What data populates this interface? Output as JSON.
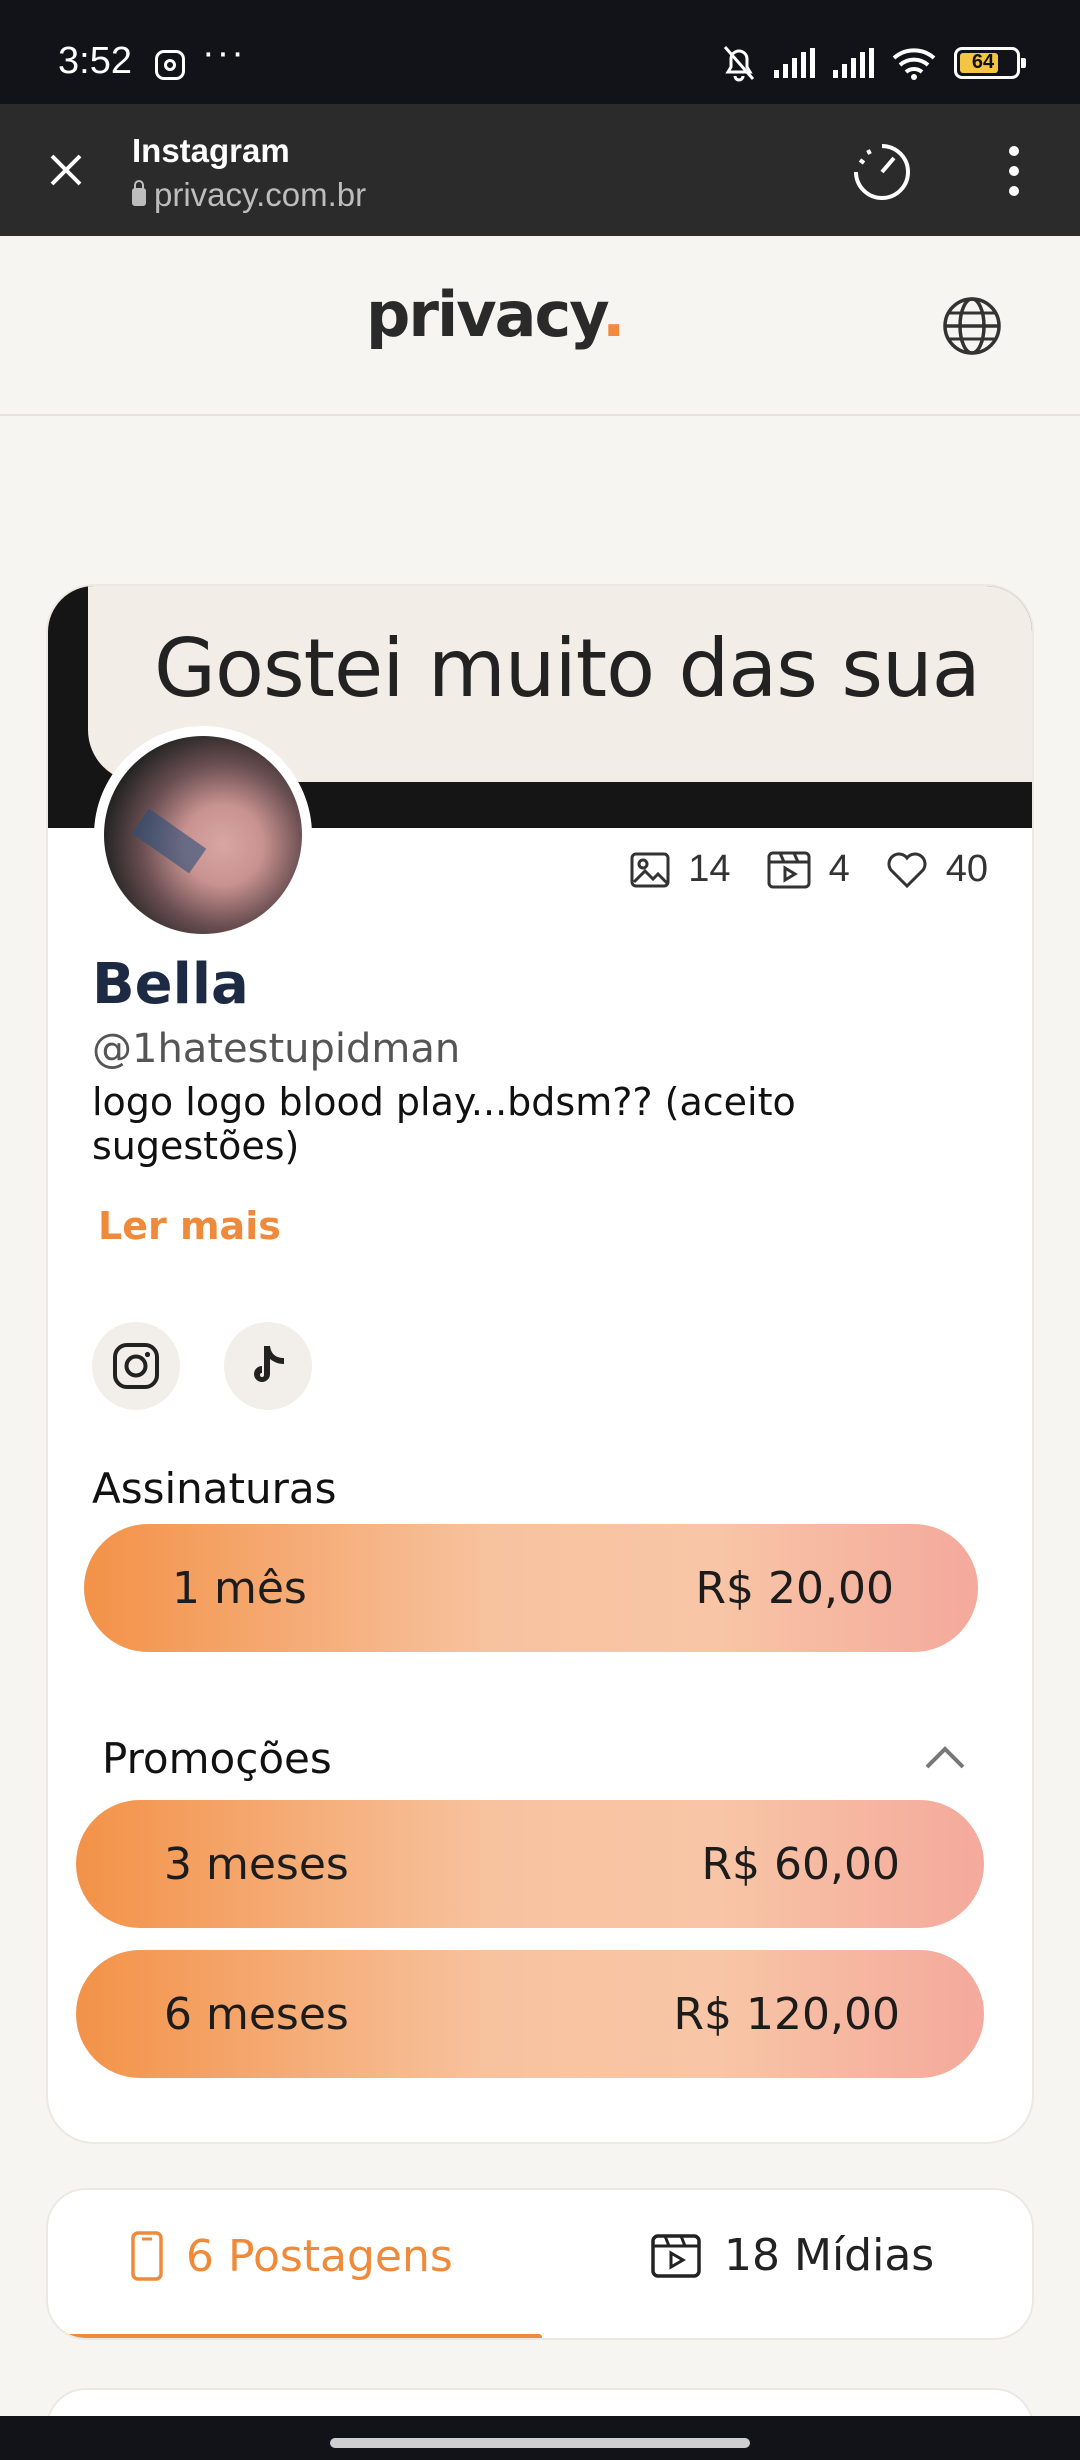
{
  "status_bar": {
    "time": "3:52",
    "battery": "64",
    "icons": [
      "instagram-icon",
      "more-dots",
      "bell-off-icon",
      "signal-icon",
      "signal-icon",
      "wifi-icon",
      "battery-icon"
    ]
  },
  "browser": {
    "title": "Instagram",
    "url": "privacy.com.br"
  },
  "site": {
    "logo": "privacy",
    "logo_dot": ".",
    "accent": "#ef8a3a"
  },
  "profile": {
    "banner_text": "Gostei muito das sua",
    "name": "Bella",
    "handle": "@1hatestupidman",
    "bio": "logo logo blood play...bdsm?? (aceito sugestões)",
    "read_more": "Ler mais",
    "stats": {
      "photos": "14",
      "videos": "4",
      "likes": "40"
    }
  },
  "subscriptions": {
    "title": "Assinaturas",
    "plans": [
      {
        "label": "1 mês",
        "price": "R$ 20,00"
      }
    ]
  },
  "promotions": {
    "title": "Promoções",
    "plans": [
      {
        "label": "3 meses",
        "price": "R$ 60,00"
      },
      {
        "label": "6 meses",
        "price": "R$ 120,00"
      }
    ]
  },
  "tabs": {
    "posts": "6 Postagens",
    "media": "18 Mídias"
  }
}
